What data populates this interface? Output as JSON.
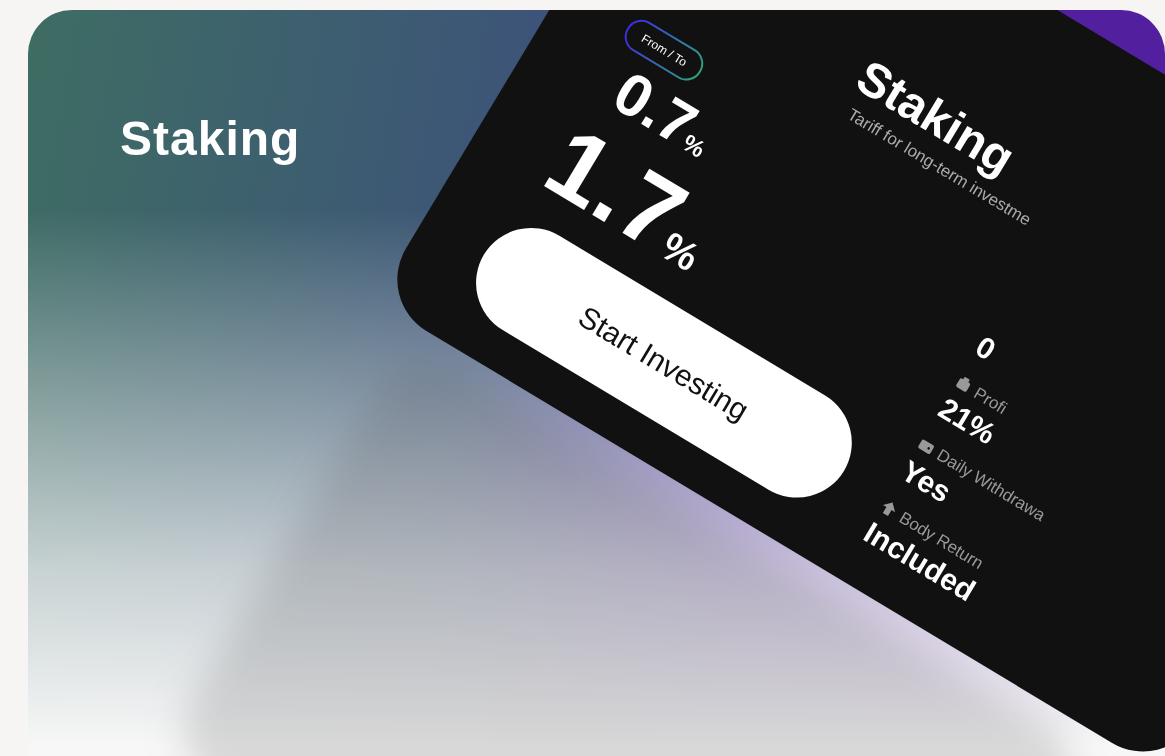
{
  "page_title": "Staking",
  "card": {
    "title": "Staking",
    "subtitle": "Tariff for long-term investme",
    "badge": "From / To",
    "rates": [
      {
        "value": "0.7",
        "unit": "%",
        "kind": "from"
      },
      {
        "value": "1.7",
        "unit": "%",
        "kind": "to"
      }
    ],
    "button": "Start Investing",
    "stats": [
      {
        "kind": "value_only",
        "value": "0"
      },
      {
        "kind": "profit",
        "label": "Profi",
        "value": "21%"
      },
      {
        "kind": "withdrawal",
        "label": "Daily Withdrawa",
        "value": "Yes"
      },
      {
        "kind": "return",
        "label": "Body Return",
        "value": "Included"
      }
    ]
  }
}
